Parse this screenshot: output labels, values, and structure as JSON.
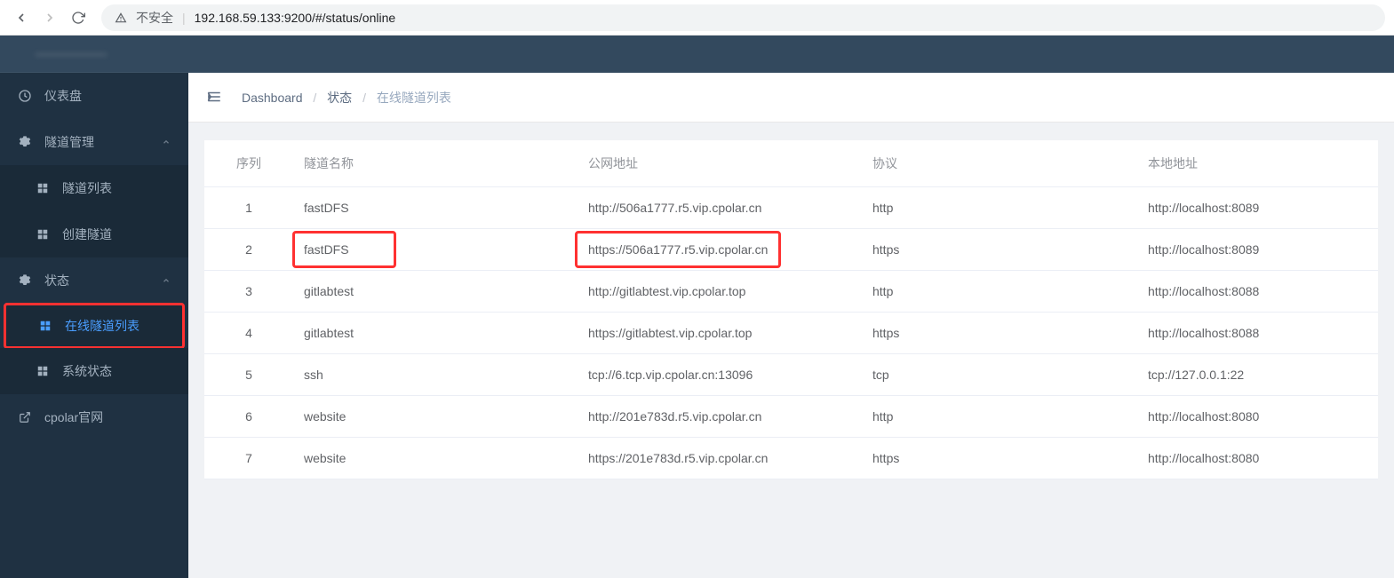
{
  "browser": {
    "not_secure": "不安全",
    "url": "192.168.59.133:9200/#/status/online"
  },
  "sidebar": {
    "dashboard": "仪表盘",
    "tunnel_mgmt": "隧道管理",
    "tunnel_list": "隧道列表",
    "create_tunnel": "创建隧道",
    "status": "状态",
    "online_tunnel_list": "在线隧道列表",
    "system_status": "系统状态",
    "cpolar_site": "cpolar官网"
  },
  "breadcrumb": {
    "dashboard": "Dashboard",
    "status": "状态",
    "online_list": "在线隧道列表"
  },
  "table": {
    "headers": {
      "seq": "序列",
      "name": "隧道名称",
      "public_url": "公网地址",
      "protocol": "协议",
      "local_address": "本地地址"
    },
    "rows": [
      {
        "seq": "1",
        "name": "fastDFS",
        "url": "http://506a1777.r5.vip.cpolar.cn",
        "proto": "http",
        "local": "http://localhost:8089"
      },
      {
        "seq": "2",
        "name": "fastDFS",
        "url": "https://506a1777.r5.vip.cpolar.cn",
        "proto": "https",
        "local": "http://localhost:8089"
      },
      {
        "seq": "3",
        "name": "gitlabtest",
        "url": "http://gitlabtest.vip.cpolar.top",
        "proto": "http",
        "local": "http://localhost:8088"
      },
      {
        "seq": "4",
        "name": "gitlabtest",
        "url": "https://gitlabtest.vip.cpolar.top",
        "proto": "https",
        "local": "http://localhost:8088"
      },
      {
        "seq": "5",
        "name": "ssh",
        "url": "tcp://6.tcp.vip.cpolar.cn:13096",
        "proto": "tcp",
        "local": "tcp://127.0.0.1:22"
      },
      {
        "seq": "6",
        "name": "website",
        "url": "http://201e783d.r5.vip.cpolar.cn",
        "proto": "http",
        "local": "http://localhost:8080"
      },
      {
        "seq": "7",
        "name": "website",
        "url": "https://201e783d.r5.vip.cpolar.cn",
        "proto": "https",
        "local": "http://localhost:8080"
      }
    ]
  }
}
